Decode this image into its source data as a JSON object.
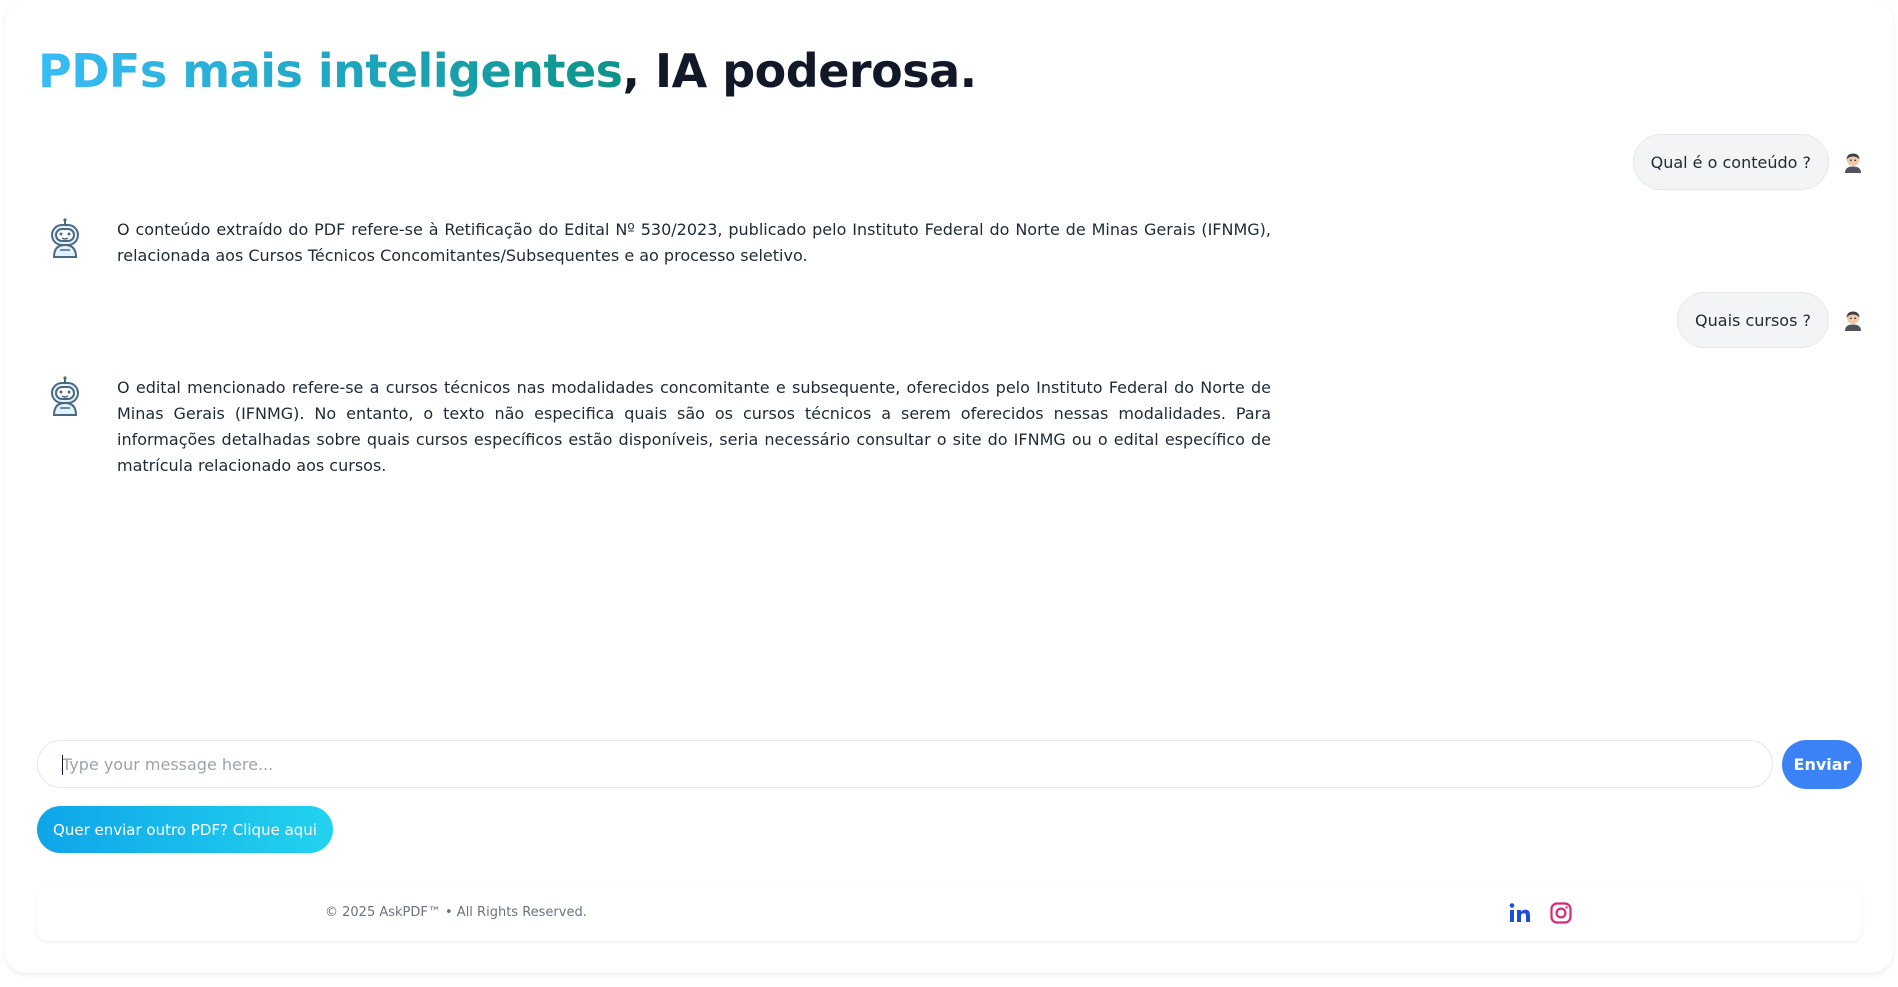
{
  "header": {
    "headline_gradient": "PDFs mais inteligentes",
    "headline_rest": ", IA poderosa."
  },
  "chat": {
    "messages": [
      {
        "role": "user",
        "text": "Qual é o conteúdo ?"
      },
      {
        "role": "bot",
        "text": "O conteúdo extraído do PDF refere-se à Retificação do Edital Nº 530/2023, publicado pelo Instituto Federal do Norte de Minas Gerais (IFNMG), relacionada aos Cursos Técnicos Concomitantes/Subsequentes e ao processo seletivo."
      },
      {
        "role": "user",
        "text": "Quais cursos ?"
      },
      {
        "role": "bot",
        "text": "O edital mencionado refere-se a cursos técnicos nas modalidades concomitante e subsequente, oferecidos pelo Instituto Federal do Norte de Minas Gerais (IFNMG). No entanto, o texto não especifica quais são os cursos técnicos a serem oferecidos nessas modalidades. Para informações detalhadas sobre quais cursos específicos estão disponíveis, seria necessário consultar o site do IFNMG ou o edital específico de matrícula relacionado aos cursos."
      }
    ],
    "user_avatar_icon": "user-avatar-icon",
    "bot_avatar_icon": "robot-icon"
  },
  "composer": {
    "placeholder": "Type your message here...",
    "value": "",
    "send_label": "Enviar"
  },
  "actions": {
    "other_pdf_label": "Quer enviar outro PDF? Clique aqui"
  },
  "footer": {
    "copyright": "© 2025 AskPDF™  • All Rights Reserved.",
    "social": [
      "linkedin-icon",
      "instagram-icon"
    ]
  },
  "colors": {
    "gradient_start": "#38bdf8",
    "gradient_end": "#0d9488",
    "send_button": "#3b82f6",
    "other_pdf_start": "#0ea5e9",
    "other_pdf_end": "#22d3ee",
    "linkedin": "#1d4ed8",
    "instagram": "#db2777"
  }
}
